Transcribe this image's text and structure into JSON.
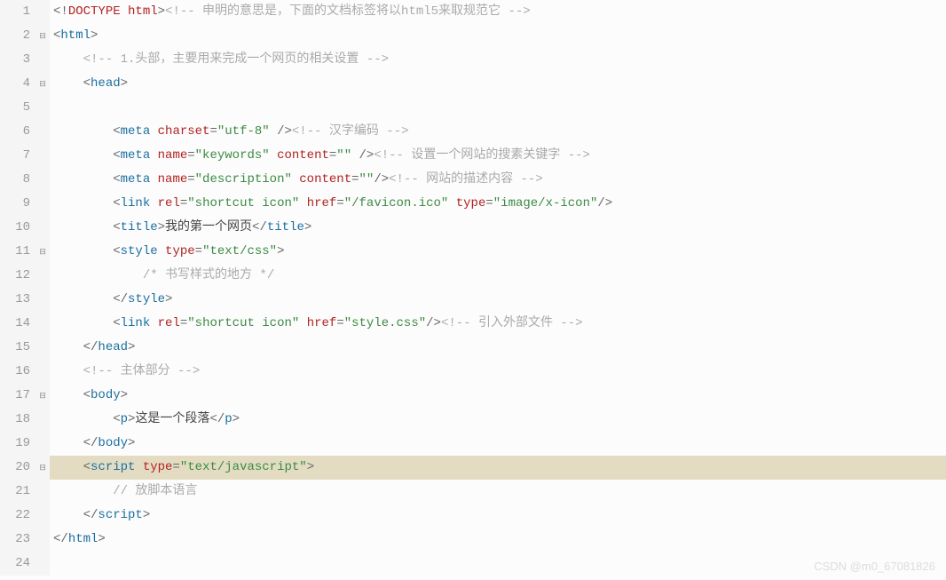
{
  "watermark": "CSDN @m0_67081826",
  "lines": [
    {
      "num": 1,
      "fold": "",
      "hl": false,
      "tokens": [
        {
          "c": "punct",
          "t": "<!"
        },
        {
          "c": "doctype",
          "t": "DOCTYPE html"
        },
        {
          "c": "punct",
          "t": ">"
        },
        {
          "c": "comment",
          "t": "<!-- 申明的意思是，下面的文档标签将以html5来取规范它 -->"
        }
      ]
    },
    {
      "num": 2,
      "fold": "⊟",
      "hl": false,
      "tokens": [
        {
          "c": "punct",
          "t": "<"
        },
        {
          "c": "tag",
          "t": "html"
        },
        {
          "c": "punct",
          "t": ">"
        }
      ]
    },
    {
      "num": 3,
      "fold": "",
      "hl": false,
      "tokens": [
        {
          "c": "",
          "t": "    "
        },
        {
          "c": "comment",
          "t": "<!-- 1.头部，主要用来完成一个网页的相关设置 -->"
        }
      ]
    },
    {
      "num": 4,
      "fold": "⊟",
      "hl": false,
      "tokens": [
        {
          "c": "",
          "t": "    "
        },
        {
          "c": "punct",
          "t": "<"
        },
        {
          "c": "tag",
          "t": "head"
        },
        {
          "c": "punct",
          "t": ">"
        }
      ]
    },
    {
      "num": 5,
      "fold": "",
      "hl": false,
      "tokens": []
    },
    {
      "num": 6,
      "fold": "",
      "hl": false,
      "tokens": [
        {
          "c": "",
          "t": "        "
        },
        {
          "c": "punct",
          "t": "<"
        },
        {
          "c": "tag",
          "t": "meta"
        },
        {
          "c": "",
          "t": " "
        },
        {
          "c": "attr",
          "t": "charset"
        },
        {
          "c": "punct",
          "t": "="
        },
        {
          "c": "str",
          "t": "\"utf-8\""
        },
        {
          "c": "",
          "t": " "
        },
        {
          "c": "punct",
          "t": "/>"
        },
        {
          "c": "comment",
          "t": "<!-- 汉字编码 -->"
        }
      ]
    },
    {
      "num": 7,
      "fold": "",
      "hl": false,
      "tokens": [
        {
          "c": "",
          "t": "        "
        },
        {
          "c": "punct",
          "t": "<"
        },
        {
          "c": "tag",
          "t": "meta"
        },
        {
          "c": "",
          "t": " "
        },
        {
          "c": "attr",
          "t": "name"
        },
        {
          "c": "punct",
          "t": "="
        },
        {
          "c": "str",
          "t": "\"keywords\""
        },
        {
          "c": "",
          "t": " "
        },
        {
          "c": "attr",
          "t": "content"
        },
        {
          "c": "punct",
          "t": "="
        },
        {
          "c": "str",
          "t": "\"\""
        },
        {
          "c": "",
          "t": " "
        },
        {
          "c": "punct",
          "t": "/>"
        },
        {
          "c": "comment",
          "t": "<!-- 设置一个网站的搜素关键字 -->"
        }
      ]
    },
    {
      "num": 8,
      "fold": "",
      "hl": false,
      "tokens": [
        {
          "c": "",
          "t": "        "
        },
        {
          "c": "punct",
          "t": "<"
        },
        {
          "c": "tag",
          "t": "meta"
        },
        {
          "c": "",
          "t": " "
        },
        {
          "c": "attr",
          "t": "name"
        },
        {
          "c": "punct",
          "t": "="
        },
        {
          "c": "str",
          "t": "\"description\""
        },
        {
          "c": "",
          "t": " "
        },
        {
          "c": "attr",
          "t": "content"
        },
        {
          "c": "punct",
          "t": "="
        },
        {
          "c": "str",
          "t": "\"\""
        },
        {
          "c": "punct",
          "t": "/>"
        },
        {
          "c": "comment",
          "t": "<!-- 网站的描述内容 -->"
        }
      ]
    },
    {
      "num": 9,
      "fold": "",
      "hl": false,
      "tokens": [
        {
          "c": "",
          "t": "        "
        },
        {
          "c": "punct",
          "t": "<"
        },
        {
          "c": "tag",
          "t": "link"
        },
        {
          "c": "",
          "t": " "
        },
        {
          "c": "attr",
          "t": "rel"
        },
        {
          "c": "punct",
          "t": "="
        },
        {
          "c": "str",
          "t": "\"shortcut icon\""
        },
        {
          "c": "",
          "t": " "
        },
        {
          "c": "attr",
          "t": "href"
        },
        {
          "c": "punct",
          "t": "="
        },
        {
          "c": "str",
          "t": "\"/favicon.ico\""
        },
        {
          "c": "",
          "t": " "
        },
        {
          "c": "attr",
          "t": "type"
        },
        {
          "c": "punct",
          "t": "="
        },
        {
          "c": "str",
          "t": "\"image/x-icon\""
        },
        {
          "c": "punct",
          "t": "/>"
        }
      ]
    },
    {
      "num": 10,
      "fold": "",
      "hl": false,
      "tokens": [
        {
          "c": "",
          "t": "        "
        },
        {
          "c": "punct",
          "t": "<"
        },
        {
          "c": "tag",
          "t": "title"
        },
        {
          "c": "punct",
          "t": ">"
        },
        {
          "c": "text",
          "t": "我的第一个网页"
        },
        {
          "c": "punct",
          "t": "</"
        },
        {
          "c": "tag",
          "t": "title"
        },
        {
          "c": "punct",
          "t": ">"
        }
      ]
    },
    {
      "num": 11,
      "fold": "⊟",
      "hl": false,
      "tokens": [
        {
          "c": "",
          "t": "        "
        },
        {
          "c": "punct",
          "t": "<"
        },
        {
          "c": "tag",
          "t": "style"
        },
        {
          "c": "",
          "t": " "
        },
        {
          "c": "attr",
          "t": "type"
        },
        {
          "c": "punct",
          "t": "="
        },
        {
          "c": "str",
          "t": "\"text/css\""
        },
        {
          "c": "punct",
          "t": ">"
        }
      ]
    },
    {
      "num": 12,
      "fold": "",
      "hl": false,
      "tokens": [
        {
          "c": "",
          "t": "            "
        },
        {
          "c": "csscomm",
          "t": "/* 书写样式的地方 */"
        }
      ]
    },
    {
      "num": 13,
      "fold": "",
      "hl": false,
      "tokens": [
        {
          "c": "",
          "t": "        "
        },
        {
          "c": "punct",
          "t": "</"
        },
        {
          "c": "tag",
          "t": "style"
        },
        {
          "c": "punct",
          "t": ">"
        }
      ]
    },
    {
      "num": 14,
      "fold": "",
      "hl": false,
      "tokens": [
        {
          "c": "",
          "t": "        "
        },
        {
          "c": "punct",
          "t": "<"
        },
        {
          "c": "tag",
          "t": "link"
        },
        {
          "c": "",
          "t": " "
        },
        {
          "c": "attr",
          "t": "rel"
        },
        {
          "c": "punct",
          "t": "="
        },
        {
          "c": "str",
          "t": "\"shortcut icon\""
        },
        {
          "c": "",
          "t": " "
        },
        {
          "c": "attr",
          "t": "href"
        },
        {
          "c": "punct",
          "t": "="
        },
        {
          "c": "str",
          "t": "\"style.css\""
        },
        {
          "c": "punct",
          "t": "/>"
        },
        {
          "c": "comment",
          "t": "<!-- 引入外部文件 -->"
        }
      ]
    },
    {
      "num": 15,
      "fold": "",
      "hl": false,
      "tokens": [
        {
          "c": "",
          "t": "    "
        },
        {
          "c": "punct",
          "t": "</"
        },
        {
          "c": "tag",
          "t": "head"
        },
        {
          "c": "punct",
          "t": ">"
        }
      ]
    },
    {
      "num": 16,
      "fold": "",
      "hl": false,
      "tokens": [
        {
          "c": "",
          "t": "    "
        },
        {
          "c": "comment",
          "t": "<!-- 主体部分 -->"
        }
      ]
    },
    {
      "num": 17,
      "fold": "⊟",
      "hl": false,
      "tokens": [
        {
          "c": "",
          "t": "    "
        },
        {
          "c": "punct",
          "t": "<"
        },
        {
          "c": "tag",
          "t": "body"
        },
        {
          "c": "punct",
          "t": ">"
        }
      ]
    },
    {
      "num": 18,
      "fold": "",
      "hl": false,
      "tokens": [
        {
          "c": "",
          "t": "        "
        },
        {
          "c": "punct",
          "t": "<"
        },
        {
          "c": "tag",
          "t": "p"
        },
        {
          "c": "punct",
          "t": ">"
        },
        {
          "c": "text",
          "t": "这是一个段落"
        },
        {
          "c": "punct",
          "t": "</"
        },
        {
          "c": "tag",
          "t": "p"
        },
        {
          "c": "punct",
          "t": ">"
        }
      ]
    },
    {
      "num": 19,
      "fold": "",
      "hl": false,
      "tokens": [
        {
          "c": "",
          "t": "    "
        },
        {
          "c": "punct",
          "t": "</"
        },
        {
          "c": "tag",
          "t": "body"
        },
        {
          "c": "punct",
          "t": ">"
        }
      ]
    },
    {
      "num": 20,
      "fold": "⊟",
      "hl": true,
      "tokens": [
        {
          "c": "",
          "t": "    "
        },
        {
          "c": "punct",
          "t": "<"
        },
        {
          "c": "tag",
          "t": "script"
        },
        {
          "c": "",
          "t": " "
        },
        {
          "c": "attr",
          "t": "type"
        },
        {
          "c": "punct",
          "t": "="
        },
        {
          "c": "str",
          "t": "\"text/javascript\""
        },
        {
          "c": "punct",
          "t": ">"
        }
      ]
    },
    {
      "num": 21,
      "fold": "",
      "hl": false,
      "tokens": [
        {
          "c": "",
          "t": "        "
        },
        {
          "c": "csscomm",
          "t": "// 放脚本语言"
        }
      ]
    },
    {
      "num": 22,
      "fold": "",
      "hl": false,
      "tokens": [
        {
          "c": "",
          "t": "    "
        },
        {
          "c": "punct",
          "t": "</"
        },
        {
          "c": "tag",
          "t": "script"
        },
        {
          "c": "punct",
          "t": ">"
        }
      ]
    },
    {
      "num": 23,
      "fold": "",
      "hl": false,
      "tokens": [
        {
          "c": "punct",
          "t": "</"
        },
        {
          "c": "tag",
          "t": "html"
        },
        {
          "c": "punct",
          "t": ">"
        }
      ]
    },
    {
      "num": 24,
      "fold": "",
      "hl": false,
      "tokens": []
    }
  ]
}
